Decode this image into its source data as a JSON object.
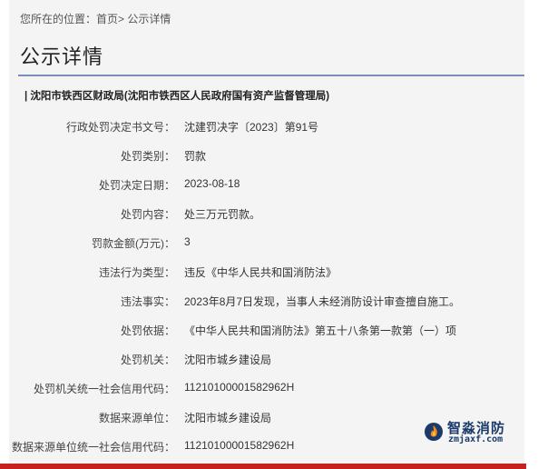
{
  "breadcrumb": {
    "prefix": "您所在的位置：",
    "home": "首页",
    "separator": ">",
    "current": "公示详情"
  },
  "page_title": "公示详情",
  "org_name": "| 沈阳市铁西区财政局(沈阳市铁西区人民政府国有资产监督管理局)",
  "fields": [
    {
      "label": "行政处罚决定书文号：",
      "value": "沈建罚决字〔2023〕第91号"
    },
    {
      "label": "处罚类别：",
      "value": "罚款"
    },
    {
      "label": "处罚决定日期：",
      "value": "2023-08-18"
    },
    {
      "label": "处罚内容：",
      "value": "处三万元罚款。"
    },
    {
      "label": "罚款金额(万元)：",
      "value": "3"
    },
    {
      "label": "违法行为类型：",
      "value": "违反《中华人民共和国消防法》"
    },
    {
      "label": "违法事实：",
      "value": "2023年8月7日发现，当事人未经消防设计审查擅自施工。"
    },
    {
      "label": "处罚依据：",
      "value": "《中华人民共和国消防法》第五十八条第一款第（一）项"
    },
    {
      "label": "处罚机关：",
      "value": "沈阳市城乡建设局"
    },
    {
      "label": "处罚机关统一社会信用代码：",
      "value": "11210100001582962H"
    },
    {
      "label": "数据来源单位：",
      "value": "沈阳市城乡建设局"
    },
    {
      "label": "数据来源单位统一社会信用代码：",
      "value": "11210100001582962H"
    }
  ],
  "watermark": {
    "name_cn": "智淼消防",
    "domain": "zmjaxf.com",
    "icon": "flame-logo-icon"
  },
  "colors": {
    "accent_rule": "#7a8fb8",
    "bottom_bar": "#c8201e",
    "panel_bg": "#f4f4f4"
  }
}
